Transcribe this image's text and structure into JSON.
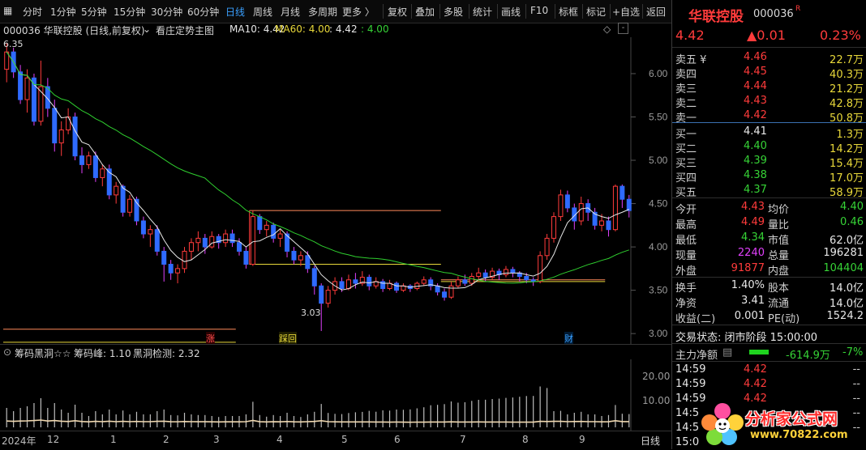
{
  "toolbar": {
    "periods": [
      "分时",
      "1分钟",
      "5分钟",
      "15分钟",
      "30分钟",
      "60分钟",
      "日线",
      "周线",
      "月线",
      "多周期",
      "更多 〉"
    ],
    "active_period": "日线",
    "tools": [
      "复权",
      "叠加",
      "多股",
      "统计",
      "画线",
      "F10",
      "标框",
      "标记",
      "+自选",
      "返回"
    ]
  },
  "info": {
    "code_name": "000036 华联控股 (日线,前复权)",
    "indicator_name": "看庄定势主图",
    "ma10_label": "MA10: 4.42",
    "ma60_label": "MA60: 4.00",
    "extra1": ": 4.42",
    "extra2": ": 4.00"
  },
  "chart_data": {
    "type": "candlestick",
    "period": "日线",
    "ylim": [
      2.88,
      6.42
    ],
    "y_ticks": [
      3.0,
      3.5,
      4.0,
      4.5,
      5.0,
      5.5,
      6.0
    ],
    "high_label": "6.35",
    "low_label": "3.03",
    "markers": [
      "涨",
      "踩回",
      "财"
    ],
    "candles": [
      [
        6.05,
        6.25,
        5.9,
        6.35
      ],
      [
        6.25,
        6.02,
        5.95,
        6.3
      ],
      [
        6.02,
        5.7,
        5.65,
        6.1
      ],
      [
        5.7,
        5.95,
        5.55,
        6.05
      ],
      [
        5.95,
        5.45,
        5.4,
        6.0
      ],
      [
        5.45,
        5.85,
        5.4,
        6.15
      ],
      [
        5.85,
        5.6,
        5.5,
        5.95
      ],
      [
        5.6,
        5.2,
        5.1,
        5.7
      ],
      [
        5.2,
        5.35,
        5.05,
        5.45
      ],
      [
        5.35,
        5.5,
        5.3,
        5.6
      ],
      [
        5.5,
        5.05,
        5.0,
        5.55
      ],
      [
        5.05,
        4.95,
        4.85,
        5.15
      ],
      [
        4.95,
        5.05,
        4.9,
        5.1
      ],
      [
        5.05,
        4.8,
        4.75,
        5.1
      ],
      [
        4.8,
        4.9,
        4.7,
        4.95
      ],
      [
        4.9,
        4.6,
        4.55,
        4.95
      ],
      [
        4.6,
        4.7,
        4.5,
        4.75
      ],
      [
        4.7,
        4.4,
        4.35,
        4.72
      ],
      [
        4.4,
        4.55,
        4.35,
        4.6
      ],
      [
        4.55,
        4.3,
        4.25,
        4.58
      ],
      [
        4.3,
        4.15,
        4.1,
        4.35
      ],
      [
        4.15,
        4.2,
        4.0,
        4.25
      ],
      [
        4.2,
        3.95,
        3.9,
        4.25
      ],
      [
        3.95,
        3.8,
        3.6,
        4.0
      ],
      [
        3.8,
        3.7,
        3.62,
        3.85
      ],
      [
        3.7,
        3.75,
        3.58,
        3.8
      ],
      [
        3.75,
        3.95,
        3.7,
        4.0
      ],
      [
        3.95,
        4.05,
        3.85,
        4.1
      ],
      [
        4.05,
        4.1,
        3.95,
        4.18
      ],
      [
        4.1,
        4.0,
        3.92,
        4.15
      ],
      [
        4.0,
        4.12,
        3.98,
        4.18
      ],
      [
        4.12,
        4.05,
        3.98,
        4.15
      ],
      [
        4.05,
        4.15,
        4.0,
        4.2
      ],
      [
        4.15,
        4.05,
        4.0,
        4.2
      ],
      [
        4.05,
        3.95,
        3.9,
        4.1
      ],
      [
        3.95,
        3.8,
        3.75,
        4.0
      ],
      [
        3.8,
        4.35,
        3.78,
        4.42
      ],
      [
        4.35,
        4.2,
        4.15,
        4.38
      ],
      [
        4.2,
        4.25,
        4.12,
        4.3
      ],
      [
        4.25,
        4.1,
        4.05,
        4.28
      ],
      [
        4.1,
        4.15,
        4.0,
        4.2
      ],
      [
        4.15,
        3.95,
        3.88,
        4.18
      ],
      [
        3.95,
        3.85,
        3.8,
        4.0
      ],
      [
        3.85,
        3.9,
        3.78,
        3.95
      ],
      [
        3.9,
        3.75,
        3.7,
        3.95
      ],
      [
        3.75,
        3.55,
        3.45,
        3.78
      ],
      [
        3.55,
        3.35,
        3.03,
        3.58
      ],
      [
        3.35,
        3.5,
        3.3,
        3.55
      ],
      [
        3.5,
        3.6,
        3.45,
        3.65
      ],
      [
        3.6,
        3.52,
        3.48,
        3.65
      ],
      [
        3.52,
        3.62,
        3.5,
        3.68
      ],
      [
        3.62,
        3.58,
        3.52,
        3.7
      ],
      [
        3.58,
        3.65,
        3.55,
        3.72
      ],
      [
        3.65,
        3.55,
        3.5,
        3.68
      ],
      [
        3.55,
        3.6,
        3.52,
        3.65
      ],
      [
        3.6,
        3.52,
        3.48,
        3.63
      ],
      [
        3.52,
        3.58,
        3.5,
        3.62
      ],
      [
        3.58,
        3.5,
        3.47,
        3.6
      ],
      [
        3.5,
        3.55,
        3.48,
        3.58
      ],
      [
        3.55,
        3.52,
        3.48,
        3.57
      ],
      [
        3.52,
        3.58,
        3.5,
        3.6
      ],
      [
        3.58,
        3.62,
        3.55,
        3.66
      ],
      [
        3.62,
        3.55,
        3.5,
        3.65
      ],
      [
        3.55,
        3.48,
        3.44,
        3.58
      ],
      [
        3.48,
        3.42,
        3.38,
        3.52
      ],
      [
        3.42,
        3.55,
        3.4,
        3.6
      ],
      [
        3.55,
        3.62,
        3.52,
        3.66
      ],
      [
        3.62,
        3.58,
        3.55,
        3.68
      ],
      [
        3.58,
        3.66,
        3.55,
        3.7
      ],
      [
        3.66,
        3.7,
        3.6,
        3.76
      ],
      [
        3.7,
        3.65,
        3.6,
        3.74
      ],
      [
        3.65,
        3.72,
        3.62,
        3.76
      ],
      [
        3.72,
        3.68,
        3.62,
        3.75
      ],
      [
        3.68,
        3.74,
        3.65,
        3.78
      ],
      [
        3.74,
        3.7,
        3.65,
        3.77
      ],
      [
        3.7,
        3.66,
        3.6,
        3.72
      ],
      [
        3.66,
        3.62,
        3.58,
        3.7
      ],
      [
        3.62,
        3.6,
        3.55,
        3.65
      ],
      [
        3.6,
        3.9,
        3.58,
        3.95
      ],
      [
        3.9,
        4.1,
        3.85,
        4.15
      ],
      [
        4.1,
        4.35,
        4.05,
        4.4
      ],
      [
        4.35,
        4.6,
        4.3,
        4.66
      ],
      [
        4.6,
        4.45,
        4.4,
        4.65
      ],
      [
        4.45,
        4.3,
        4.2,
        4.5
      ],
      [
        4.3,
        4.5,
        4.25,
        4.58
      ],
      [
        4.5,
        4.4,
        4.3,
        4.55
      ],
      [
        4.4,
        4.25,
        4.2,
        4.45
      ],
      [
        4.25,
        4.3,
        4.18,
        4.38
      ],
      [
        4.3,
        4.2,
        4.12,
        4.35
      ],
      [
        4.2,
        4.7,
        4.18,
        4.72
      ],
      [
        4.7,
        4.55,
        4.45,
        4.72
      ],
      [
        4.55,
        4.42,
        4.34,
        4.6
      ]
    ]
  },
  "indicator": {
    "name": "筹码黑洞☆☆",
    "peak_label": "筹码峰: 1.10",
    "detect_label": "黑洞检测: 2.32",
    "y_ticks": [
      "20.00",
      "10.00"
    ]
  },
  "dates": [
    "2024年",
    "12",
    "1",
    "2",
    "3",
    "4",
    "5",
    "6",
    "7",
    "8",
    "9"
  ],
  "date_right": "日线",
  "quote": {
    "name": "华联控股",
    "code": "000036",
    "badge": "R",
    "price": "4.42",
    "change": "▲0.01",
    "pct": "0.23%",
    "sells": [
      {
        "label": "卖五 ¥",
        "price": "4.46",
        "vol": "22.7万"
      },
      {
        "label": "卖四",
        "price": "4.45",
        "vol": "40.3万"
      },
      {
        "label": "卖三",
        "price": "4.44",
        "vol": "21.2万"
      },
      {
        "label": "卖二",
        "price": "4.43",
        "vol": "42.8万"
      },
      {
        "label": "卖一",
        "price": "4.42",
        "vol": "50.8万"
      }
    ],
    "buys": [
      {
        "label": "买一",
        "price": "4.41",
        "vol": "1.3万"
      },
      {
        "label": "买二",
        "price": "4.40",
        "vol": "14.2万"
      },
      {
        "label": "买三",
        "price": "4.39",
        "vol": "15.4万"
      },
      {
        "label": "买四",
        "price": "4.38",
        "vol": "17.0万"
      },
      {
        "label": "买五",
        "price": "4.37",
        "vol": "58.9万"
      }
    ],
    "stats": [
      {
        "l1": "今开",
        "v1": "4.43",
        "l2": "均价",
        "v2": "4.40"
      },
      {
        "l1": "最高",
        "v1": "4.49",
        "l2": "量比",
        "v2": "0.46"
      },
      {
        "l1": "最低",
        "v1": "4.34",
        "l2": "市值",
        "v2": "62.0亿"
      },
      {
        "l1": "现量",
        "v1": "2240",
        "l2": "总量",
        "v2": "196281"
      },
      {
        "l1": "外盘",
        "v1": "91877",
        "l2": "内盘",
        "v2": "104404"
      }
    ],
    "stats2": [
      {
        "l1": "换手",
        "v1": "1.40%",
        "l2": "股本",
        "v2": "14.0亿"
      },
      {
        "l1": "净资",
        "v1": "3.41",
        "l2": "流通",
        "v2": "14.0亿"
      },
      {
        "l1": "收益(二)",
        "v1": "0.001",
        "l2": "PE(动)",
        "v2": "1524.2"
      }
    ],
    "status": "交易状态: 闭市阶段 15:00:00",
    "mainflow_label": "主力净额",
    "mainflow_value": "-614.9万",
    "mainflow_pct": "-7%",
    "ticks": [
      {
        "time": "14:59",
        "price": "4.42",
        "vol": "--"
      },
      {
        "time": "14:59",
        "price": "4.42",
        "vol": "--"
      },
      {
        "time": "14:59",
        "price": "4.42",
        "vol": "--"
      },
      {
        "time": "14:5",
        "price": "",
        "vol": "--"
      },
      {
        "time": "14:5",
        "price": "",
        "vol": "--"
      },
      {
        "time": "15:0",
        "price": "",
        "vol": ""
      }
    ],
    "watermark1": "分析家公式网",
    "watermark2": "www.70822.com"
  }
}
